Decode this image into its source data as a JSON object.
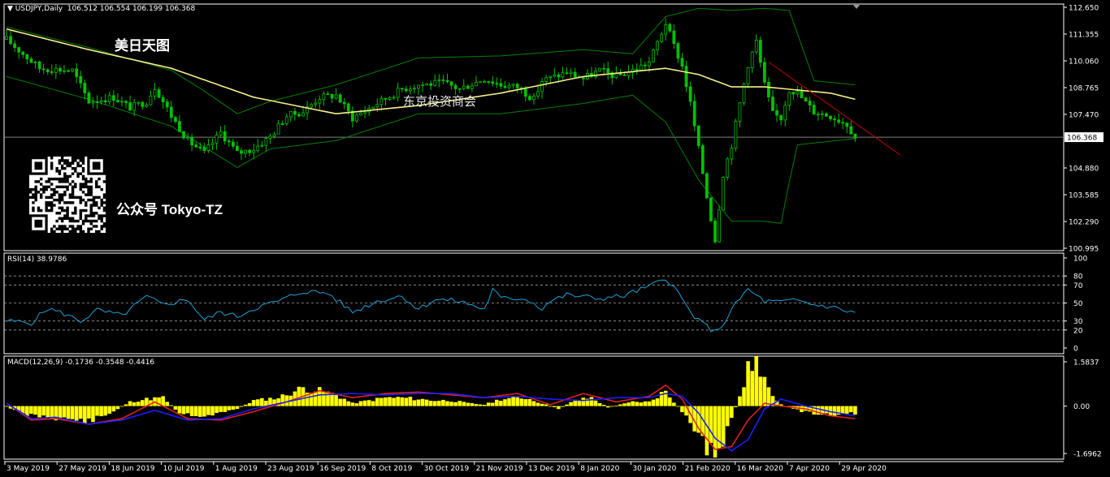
{
  "header": {
    "symbol": "USDJPY,Daily",
    "ohlc": "106.512 106.554 106.199 106.368"
  },
  "overlays": {
    "title_cn": "美日天图",
    "watermark_cn": "东京投资商会",
    "account_cn": "公众号 Tokyo-TZ",
    "qr_icon": "qr-code-icon"
  },
  "rsi": {
    "label": "RSI(14) 38.9786",
    "levels": [
      80,
      70,
      50,
      30,
      20
    ]
  },
  "macd": {
    "label": "MACD(12,26,9) -0.1736 -0.3548 -0.4416"
  },
  "colors": {
    "background": "#000000",
    "axis": "#ffffff",
    "candles": "#00c000",
    "bands": "#008000",
    "ma": "#f5f08a",
    "rsi": "#1fa0d8",
    "macd_hist": "#ffff00",
    "macd_main": "#e02020",
    "macd_signal": "#1c1cff",
    "trendline": "#c00000",
    "price_line": "#808080"
  },
  "chart_data": [
    {
      "type": "candlestick",
      "title": "USDJPY,Daily",
      "y_ticks": [
        "112.650",
        "111.355",
        "110.060",
        "108.765",
        "107.470",
        "106.368",
        "104.880",
        "103.585",
        "102.290",
        "100.995"
      ],
      "ylim": [
        100.995,
        112.65
      ],
      "current_price": "106.368",
      "x_ticks": [
        "3 May 2019",
        "27 May 2019",
        "18 Jun 2019",
        "10 Jul 2019",
        "1 Aug 2019",
        "23 Aug 2019",
        "16 Sep 2019",
        "8 Oct 2019",
        "30 Oct 2019",
        "21 Nov 2019",
        "13 Dec 2019",
        "8 Jan 2020",
        "30 Jan 2020",
        "21 Feb 2020",
        "16 Mar 2020",
        "7 Apr 2020",
        "29 Apr 2020"
      ],
      "close_path": [
        [
          0,
          111.1
        ],
        [
          8,
          109.7
        ],
        [
          16,
          109.6
        ],
        [
          20,
          108.1
        ],
        [
          26,
          108.3
        ],
        [
          30,
          107.8
        ],
        [
          34,
          108.1
        ],
        [
          36,
          108.8
        ],
        [
          40,
          107.4
        ],
        [
          44,
          106.2
        ],
        [
          48,
          105.6
        ],
        [
          52,
          106.6
        ],
        [
          56,
          105.6
        ],
        [
          60,
          105.8
        ],
        [
          64,
          106.4
        ],
        [
          68,
          107.4
        ],
        [
          72,
          107.6
        ],
        [
          76,
          108.3
        ],
        [
          80,
          108.4
        ],
        [
          84,
          107.3
        ],
        [
          90,
          108.0
        ],
        [
          96,
          108.7
        ],
        [
          100,
          108.9
        ],
        [
          106,
          109.0
        ],
        [
          110,
          108.7
        ],
        [
          116,
          109.2
        ],
        [
          120,
          108.9
        ],
        [
          124,
          108.8
        ],
        [
          128,
          108.2
        ],
        [
          130,
          109.1
        ],
        [
          136,
          109.5
        ],
        [
          140,
          109.2
        ],
        [
          144,
          109.6
        ],
        [
          148,
          109.3
        ],
        [
          152,
          109.6
        ],
        [
          156,
          110.0
        ],
        [
          160,
          111.9
        ],
        [
          162,
          110.8
        ],
        [
          164,
          109.8
        ],
        [
          166,
          108.0
        ],
        [
          168,
          105.8
        ],
        [
          170,
          103.5
        ],
        [
          172,
          101.4
        ],
        [
          173,
          103.0
        ],
        [
          174,
          104.6
        ],
        [
          176,
          106.0
        ],
        [
          178,
          108.0
        ],
        [
          180,
          109.9
        ],
        [
          182,
          111.0
        ],
        [
          184,
          108.9
        ],
        [
          186,
          107.5
        ],
        [
          188,
          107.3
        ],
        [
          190,
          108.7
        ],
        [
          192,
          108.5
        ],
        [
          196,
          107.6
        ],
        [
          200,
          107.4
        ],
        [
          204,
          107.0
        ],
        [
          206,
          106.37
        ]
      ],
      "ma_path": [
        [
          0,
          111.6
        ],
        [
          20,
          110.6
        ],
        [
          40,
          109.7
        ],
        [
          60,
          108.3
        ],
        [
          80,
          107.5
        ],
        [
          100,
          107.9
        ],
        [
          120,
          108.5
        ],
        [
          140,
          109.3
        ],
        [
          160,
          109.7
        ],
        [
          168,
          109.4
        ],
        [
          176,
          108.8
        ],
        [
          184,
          108.8
        ],
        [
          200,
          108.5
        ],
        [
          206,
          108.2
        ]
      ],
      "upper_band": [
        [
          0,
          111.7
        ],
        [
          20,
          110.7
        ],
        [
          40,
          109.6
        ],
        [
          48,
          108.6
        ],
        [
          56,
          107.5
        ],
        [
          64,
          108.1
        ],
        [
          80,
          108.9
        ],
        [
          100,
          110.2
        ],
        [
          120,
          110.3
        ],
        [
          140,
          110.6
        ],
        [
          152,
          110.4
        ],
        [
          160,
          112.2
        ],
        [
          168,
          112.6
        ],
        [
          176,
          112.5
        ],
        [
          184,
          112.6
        ],
        [
          190,
          112.5
        ],
        [
          196,
          109.1
        ],
        [
          206,
          108.9
        ]
      ],
      "lower_band": [
        [
          0,
          109.3
        ],
        [
          20,
          108.2
        ],
        [
          40,
          106.9
        ],
        [
          56,
          104.9
        ],
        [
          64,
          105.8
        ],
        [
          80,
          106.2
        ],
        [
          100,
          107.5
        ],
        [
          120,
          107.5
        ],
        [
          140,
          108.0
        ],
        [
          152,
          108.4
        ],
        [
          160,
          107.1
        ],
        [
          168,
          104.3
        ],
        [
          176,
          102.3
        ],
        [
          184,
          102.3
        ],
        [
          188,
          102.2
        ],
        [
          190,
          104.2
        ],
        [
          192,
          106.0
        ],
        [
          206,
          106.3
        ]
      ],
      "trendline": [
        [
          185,
          110.0
        ],
        [
          217,
          105.5
        ]
      ]
    },
    {
      "type": "line",
      "title": "RSI(14) 38.9786",
      "y_ticks": [
        "100",
        "80",
        "70",
        "50",
        "30",
        "20",
        "0"
      ],
      "ylim": [
        0,
        100
      ],
      "levels": [
        80,
        70,
        50,
        30,
        20
      ],
      "points": [
        [
          0,
          30
        ],
        [
          6,
          28
        ],
        [
          10,
          44
        ],
        [
          14,
          38
        ],
        [
          18,
          30
        ],
        [
          22,
          42
        ],
        [
          28,
          36
        ],
        [
          34,
          57
        ],
        [
          38,
          48
        ],
        [
          44,
          54
        ],
        [
          48,
          31
        ],
        [
          52,
          40
        ],
        [
          56,
          35
        ],
        [
          60,
          44
        ],
        [
          66,
          52
        ],
        [
          72,
          63
        ],
        [
          78,
          61
        ],
        [
          84,
          40
        ],
        [
          90,
          52
        ],
        [
          96,
          58
        ],
        [
          100,
          43
        ],
        [
          104,
          54
        ],
        [
          110,
          52
        ],
        [
          116,
          43
        ],
        [
          118,
          65
        ],
        [
          120,
          55
        ],
        [
          126,
          55
        ],
        [
          130,
          44
        ],
        [
          132,
          52
        ],
        [
          136,
          59
        ],
        [
          140,
          57
        ],
        [
          144,
          55
        ],
        [
          150,
          58
        ],
        [
          152,
          62
        ],
        [
          156,
          68
        ],
        [
          160,
          78
        ],
        [
          162,
          68
        ],
        [
          166,
          40
        ],
        [
          168,
          30
        ],
        [
          172,
          18
        ],
        [
          174,
          27
        ],
        [
          176,
          42
        ],
        [
          178,
          55
        ],
        [
          180,
          65
        ],
        [
          184,
          52
        ],
        [
          188,
          51
        ],
        [
          192,
          53
        ],
        [
          196,
          48
        ],
        [
          200,
          46
        ],
        [
          204,
          41
        ],
        [
          206,
          39
        ]
      ]
    },
    {
      "type": "bar+line",
      "title": "MACD(12,26,9) -0.1736 -0.3548 -0.4416",
      "y_ticks": [
        "1.5837",
        "0.00",
        "-1.6962"
      ],
      "ylim": [
        -1.6962,
        1.5837
      ],
      "histogram": [
        [
          0,
          0.0
        ],
        [
          4,
          -0.3
        ],
        [
          8,
          -0.35
        ],
        [
          14,
          -0.45
        ],
        [
          20,
          -0.55
        ],
        [
          24,
          -0.35
        ],
        [
          30,
          0.15
        ],
        [
          34,
          0.25
        ],
        [
          38,
          0.3
        ],
        [
          42,
          -0.25
        ],
        [
          48,
          -0.35
        ],
        [
          52,
          -0.25
        ],
        [
          56,
          -0.1
        ],
        [
          60,
          0.2
        ],
        [
          66,
          0.3
        ],
        [
          72,
          0.65
        ],
        [
          76,
          0.55
        ],
        [
          80,
          0.4
        ],
        [
          84,
          0.1
        ],
        [
          88,
          0.2
        ],
        [
          92,
          0.3
        ],
        [
          96,
          0.3
        ],
        [
          100,
          0.25
        ],
        [
          104,
          0.2
        ],
        [
          108,
          0.2
        ],
        [
          112,
          0.1
        ],
        [
          116,
          0.05
        ],
        [
          120,
          0.25
        ],
        [
          126,
          0.3
        ],
        [
          130,
          0.1
        ],
        [
          134,
          -0.1
        ],
        [
          138,
          0.2
        ],
        [
          142,
          0.3
        ],
        [
          146,
          -0.05
        ],
        [
          152,
          0.15
        ],
        [
          156,
          0.15
        ],
        [
          160,
          0.55
        ],
        [
          162,
          0.15
        ],
        [
          164,
          -0.2
        ],
        [
          166,
          -0.6
        ],
        [
          168,
          -1.0
        ],
        [
          170,
          -1.45
        ],
        [
          172,
          -1.7
        ],
        [
          174,
          -1.2
        ],
        [
          176,
          -0.5
        ],
        [
          178,
          0.4
        ],
        [
          180,
          1.3
        ],
        [
          182,
          1.6
        ],
        [
          184,
          1.0
        ],
        [
          186,
          0.3
        ],
        [
          188,
          0.05
        ],
        [
          192,
          -0.15
        ],
        [
          196,
          -0.25
        ],
        [
          200,
          -0.3
        ],
        [
          204,
          -0.3
        ],
        [
          206,
          -0.25
        ]
      ],
      "macd_line": [
        [
          0,
          0.1
        ],
        [
          6,
          -0.5
        ],
        [
          12,
          -0.45
        ],
        [
          20,
          -0.65
        ],
        [
          28,
          -0.45
        ],
        [
          36,
          0.15
        ],
        [
          44,
          -0.45
        ],
        [
          52,
          -0.5
        ],
        [
          60,
          -0.2
        ],
        [
          68,
          0.15
        ],
        [
          76,
          0.55
        ],
        [
          84,
          0.3
        ],
        [
          92,
          0.45
        ],
        [
          100,
          0.5
        ],
        [
          108,
          0.4
        ],
        [
          116,
          0.3
        ],
        [
          124,
          0.45
        ],
        [
          132,
          0.05
        ],
        [
          140,
          0.45
        ],
        [
          148,
          0.15
        ],
        [
          156,
          0.35
        ],
        [
          160,
          0.75
        ],
        [
          164,
          0.25
        ],
        [
          168,
          -0.8
        ],
        [
          172,
          -1.55
        ],
        [
          176,
          -1.45
        ],
        [
          180,
          -0.5
        ],
        [
          184,
          0.1
        ],
        [
          188,
          0.0
        ],
        [
          194,
          -0.1
        ],
        [
          200,
          -0.35
        ],
        [
          206,
          -0.45
        ]
      ],
      "signal_line": [
        [
          0,
          0.1
        ],
        [
          6,
          -0.45
        ],
        [
          12,
          -0.4
        ],
        [
          20,
          -0.65
        ],
        [
          28,
          -0.5
        ],
        [
          36,
          -0.15
        ],
        [
          44,
          -0.5
        ],
        [
          52,
          -0.45
        ],
        [
          60,
          -0.1
        ],
        [
          68,
          0.15
        ],
        [
          76,
          0.4
        ],
        [
          84,
          0.45
        ],
        [
          92,
          0.4
        ],
        [
          100,
          0.45
        ],
        [
          108,
          0.45
        ],
        [
          116,
          0.3
        ],
        [
          124,
          0.35
        ],
        [
          132,
          0.25
        ],
        [
          140,
          0.2
        ],
        [
          148,
          0.3
        ],
        [
          156,
          0.3
        ],
        [
          160,
          0.45
        ],
        [
          164,
          0.35
        ],
        [
          168,
          -0.25
        ],
        [
          172,
          -1.15
        ],
        [
          176,
          -1.6
        ],
        [
          180,
          -1.2
        ],
        [
          184,
          -0.1
        ],
        [
          188,
          0.25
        ],
        [
          194,
          0.0
        ],
        [
          200,
          -0.2
        ],
        [
          206,
          -0.35
        ]
      ]
    }
  ]
}
